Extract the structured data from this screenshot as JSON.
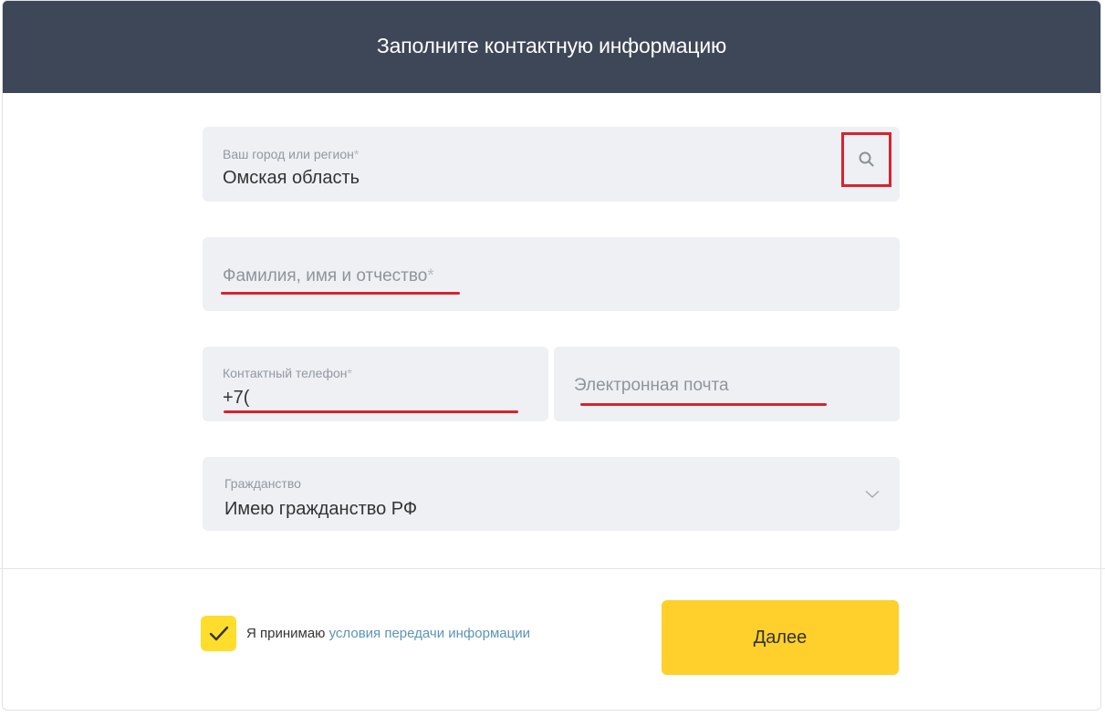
{
  "header": {
    "title": "Заполните контактную информацию"
  },
  "region": {
    "label": "Ваш город или регион",
    "required_mark": "*",
    "value": "Омская область",
    "icon": "search-icon"
  },
  "full_name": {
    "placeholder": "Фамилия, имя и отчество",
    "required_mark": "*"
  },
  "phone": {
    "label": "Контактный телефон",
    "required_mark": "*",
    "value": "+7("
  },
  "email": {
    "placeholder": "Электронная почта"
  },
  "citizenship": {
    "label": "Гражданство",
    "value": "Имею гражданство РФ",
    "icon": "chevron-down-icon"
  },
  "consent": {
    "prefix": "Я принимаю ",
    "link": "условия передачи информации",
    "checked": true
  },
  "next_button": {
    "label": "Далее"
  },
  "colors": {
    "header_bg": "#3e4757",
    "accent": "#ffdd2d",
    "annotation": "#d8232e",
    "link": "#5b93b8"
  }
}
